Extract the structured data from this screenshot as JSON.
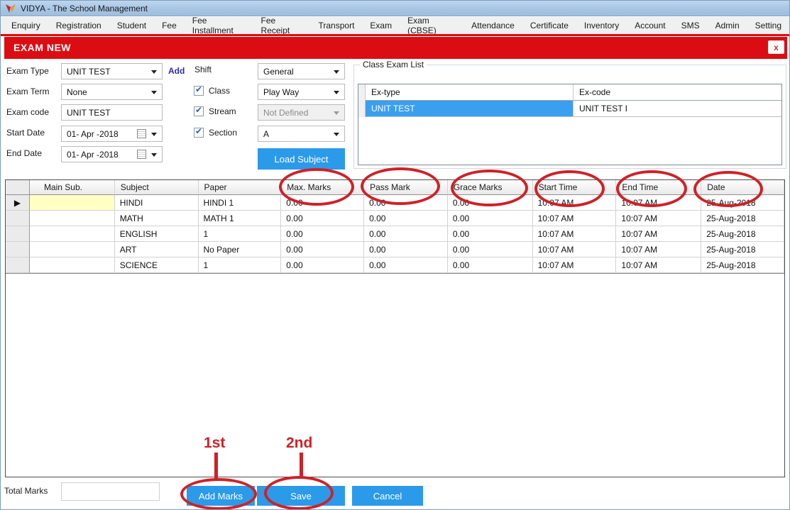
{
  "window": {
    "title": "VIDYA - The School Management"
  },
  "menu": {
    "items": [
      "Enquiry",
      "Registration",
      "Student",
      "Fee",
      "Fee Installment",
      "Fee Receipt",
      "Transport",
      "Exam",
      "Exam (CBSE)",
      "Attendance",
      "Certificate",
      "Inventory",
      "Account",
      "SMS",
      "Admin",
      "Setting"
    ]
  },
  "banner": {
    "title": "EXAM NEW",
    "close_label": "x"
  },
  "form": {
    "exam_type": {
      "label": "Exam Type",
      "value": "UNIT TEST"
    },
    "add_link": "Add",
    "shift": {
      "label": "Shift",
      "value": "General"
    },
    "exam_term": {
      "label": "Exam Term",
      "value": "None"
    },
    "class": {
      "label": "Class",
      "checked": true,
      "value": "Play Way"
    },
    "exam_code": {
      "label": "Exam code",
      "value": "UNIT TEST"
    },
    "stream": {
      "label": "Stream",
      "checked": true,
      "value": "Not Defined",
      "disabled": true
    },
    "start_date": {
      "label": "Start Date",
      "value": "01- Apr -2018"
    },
    "section": {
      "label": "Section",
      "checked": true,
      "value": "A"
    },
    "end_date": {
      "label": "End Date",
      "value": "01- Apr -2018"
    },
    "load_subject_label": "Load Subject"
  },
  "class_exam_list": {
    "title": "Class Exam List",
    "columns": [
      "Ex-type",
      "Ex-code"
    ],
    "rows": [
      {
        "ex_type": "UNIT TEST",
        "ex_code": "UNIT TEST I",
        "selected": true
      }
    ]
  },
  "subjects_grid": {
    "columns": [
      "Main Sub.",
      "Subject",
      "Paper",
      "Max. Marks",
      "Pass Mark",
      "Grace Marks",
      "Start Time",
      "End Time",
      "Date"
    ],
    "rows": [
      [
        "",
        "HINDI",
        "HINDI 1",
        "0.00",
        "0.00",
        "0.00",
        "10:07 AM",
        "10:07 AM",
        "25-Aug-2018"
      ],
      [
        "",
        "MATH",
        "MATH 1",
        "0.00",
        "0.00",
        "0.00",
        "10:07 AM",
        "10:07 AM",
        "25-Aug-2018"
      ],
      [
        "",
        "ENGLISH",
        "1",
        "0.00",
        "0.00",
        "0.00",
        "10:07 AM",
        "10:07 AM",
        "25-Aug-2018"
      ],
      [
        "",
        "ART",
        "No Paper",
        "0.00",
        "0.00",
        "0.00",
        "10:07 AM",
        "10:07 AM",
        "25-Aug-2018"
      ],
      [
        "",
        "SCIENCE",
        "1",
        "0.00",
        "0.00",
        "0.00",
        "10:07 AM",
        "10:07 AM",
        "25-Aug-2018"
      ]
    ]
  },
  "footer": {
    "total_marks_label": "Total Marks",
    "total_marks_value": "",
    "add_marks_label": "Add Marks",
    "save_label": "Save",
    "cancel_label": "Cancel"
  },
  "annotations": {
    "first": "1st",
    "second": "2nd",
    "color": "#cf2127",
    "circled_columns": [
      "Max. Marks",
      "Pass Mark",
      "Grace Marks",
      "Start Time",
      "End Time",
      "Date"
    ],
    "circled_buttons": [
      "Add Marks",
      "Save"
    ]
  },
  "colors": {
    "banner_red": "#dc0d12",
    "accent_blue": "#2b9ae9",
    "selection_blue": "#3b9ff0",
    "highlight_yellow": "#ffffc4",
    "annotation_red": "#cf2127",
    "titlebar_blue": "#a9c7e5"
  }
}
